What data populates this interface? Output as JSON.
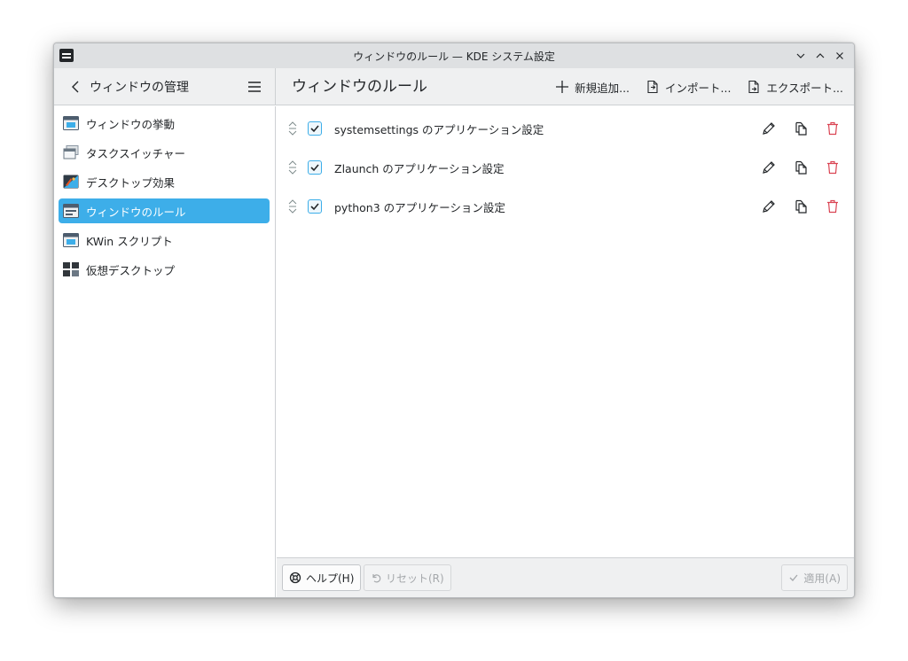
{
  "window": {
    "title": "ウィンドウのルール — KDE システム設定"
  },
  "nav": {
    "title": "ウィンドウの管理",
    "items": [
      {
        "label": "ウィンドウの挙動",
        "icon": "window-behavior-icon",
        "active": false
      },
      {
        "label": "タスクスイッチャー",
        "icon": "task-switcher-icon",
        "active": false
      },
      {
        "label": "デスクトップ効果",
        "icon": "desktop-effects-icon",
        "active": false
      },
      {
        "label": "ウィンドウのルール",
        "icon": "window-rules-icon",
        "active": true
      },
      {
        "label": "KWin スクリプト",
        "icon": "kwin-scripts-icon",
        "active": false
      },
      {
        "label": "仮想デスクトップ",
        "icon": "virtual-desktops-icon",
        "active": false
      }
    ]
  },
  "page": {
    "title": "ウィンドウのルール",
    "actions": {
      "add": "新規追加...",
      "import": "インポート...",
      "export": "エクスポート..."
    }
  },
  "rules": [
    {
      "label": "systemsettings のアプリケーション設定",
      "checked": true
    },
    {
      "label": "Zlaunch のアプリケーション設定",
      "checked": true
    },
    {
      "label": "python3 のアプリケーション設定",
      "checked": true
    }
  ],
  "footer": {
    "help": "ヘルプ(H)",
    "reset": "リセット(R)",
    "apply": "適用(A)"
  },
  "colors": {
    "accent": "#3daee9",
    "delete": "#da4453",
    "text": "#232629"
  }
}
